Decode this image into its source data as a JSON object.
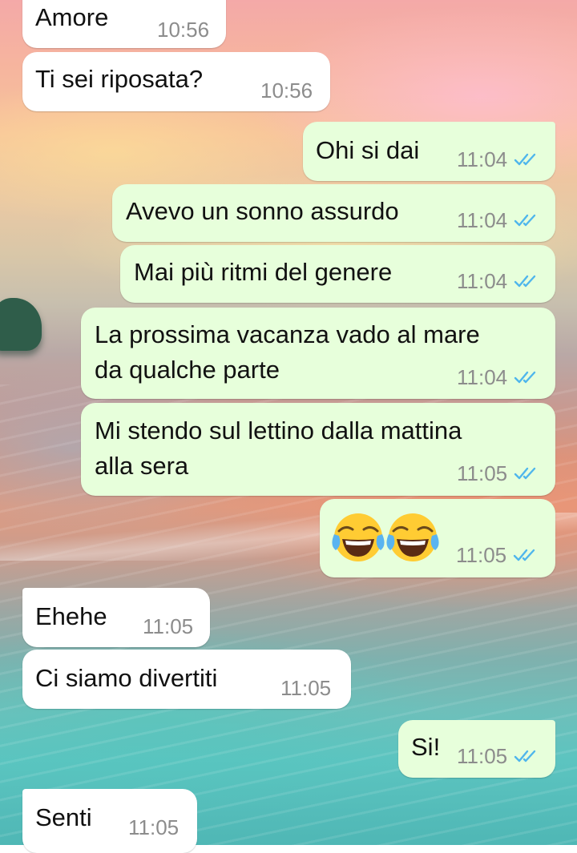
{
  "conversation": {
    "messages": [
      {
        "direction": "incoming",
        "text": "Amore",
        "time": "10:56"
      },
      {
        "direction": "incoming",
        "text": "Ti sei riposata?",
        "time": "10:56"
      },
      {
        "direction": "outgoing",
        "text": "Ohi si dai",
        "time": "11:04",
        "status": "read"
      },
      {
        "direction": "outgoing",
        "text": "Avevo un sonno assurdo",
        "time": "11:04",
        "status": "read"
      },
      {
        "direction": "outgoing",
        "text": "Mai più ritmi del genere",
        "time": "11:04",
        "status": "read"
      },
      {
        "direction": "outgoing",
        "text_line1": "La prossima vacanza vado al mare",
        "text_line2": "da qualche parte",
        "time": "11:04",
        "status": "read"
      },
      {
        "direction": "outgoing",
        "text_line1": "Mi stendo sul lettino dalla mattina",
        "text_line2": "alla sera",
        "time": "11:05",
        "status": "read"
      },
      {
        "direction": "outgoing",
        "emoji": [
          "face-with-tears-of-joy",
          "face-with-tears-of-joy"
        ],
        "time": "11:05",
        "status": "read"
      },
      {
        "direction": "incoming",
        "text": "Ehehe",
        "time": "11:05"
      },
      {
        "direction": "incoming",
        "text": "Ci siamo divertiti",
        "time": "11:05"
      },
      {
        "direction": "outgoing",
        "text": "Si!",
        "time": "11:05",
        "status": "read"
      },
      {
        "direction": "incoming",
        "text": "Senti",
        "time": "11:05"
      }
    ]
  },
  "colors": {
    "incoming_bubble": "#ffffff",
    "outgoing_bubble": "#e7ffdb",
    "timestamp": "#8c8c8c",
    "read_ticks": "#4fb6ec"
  },
  "icons": {
    "read_receipt": "double-check-icon",
    "emoji": "face-with-tears-of-joy-emoji"
  }
}
